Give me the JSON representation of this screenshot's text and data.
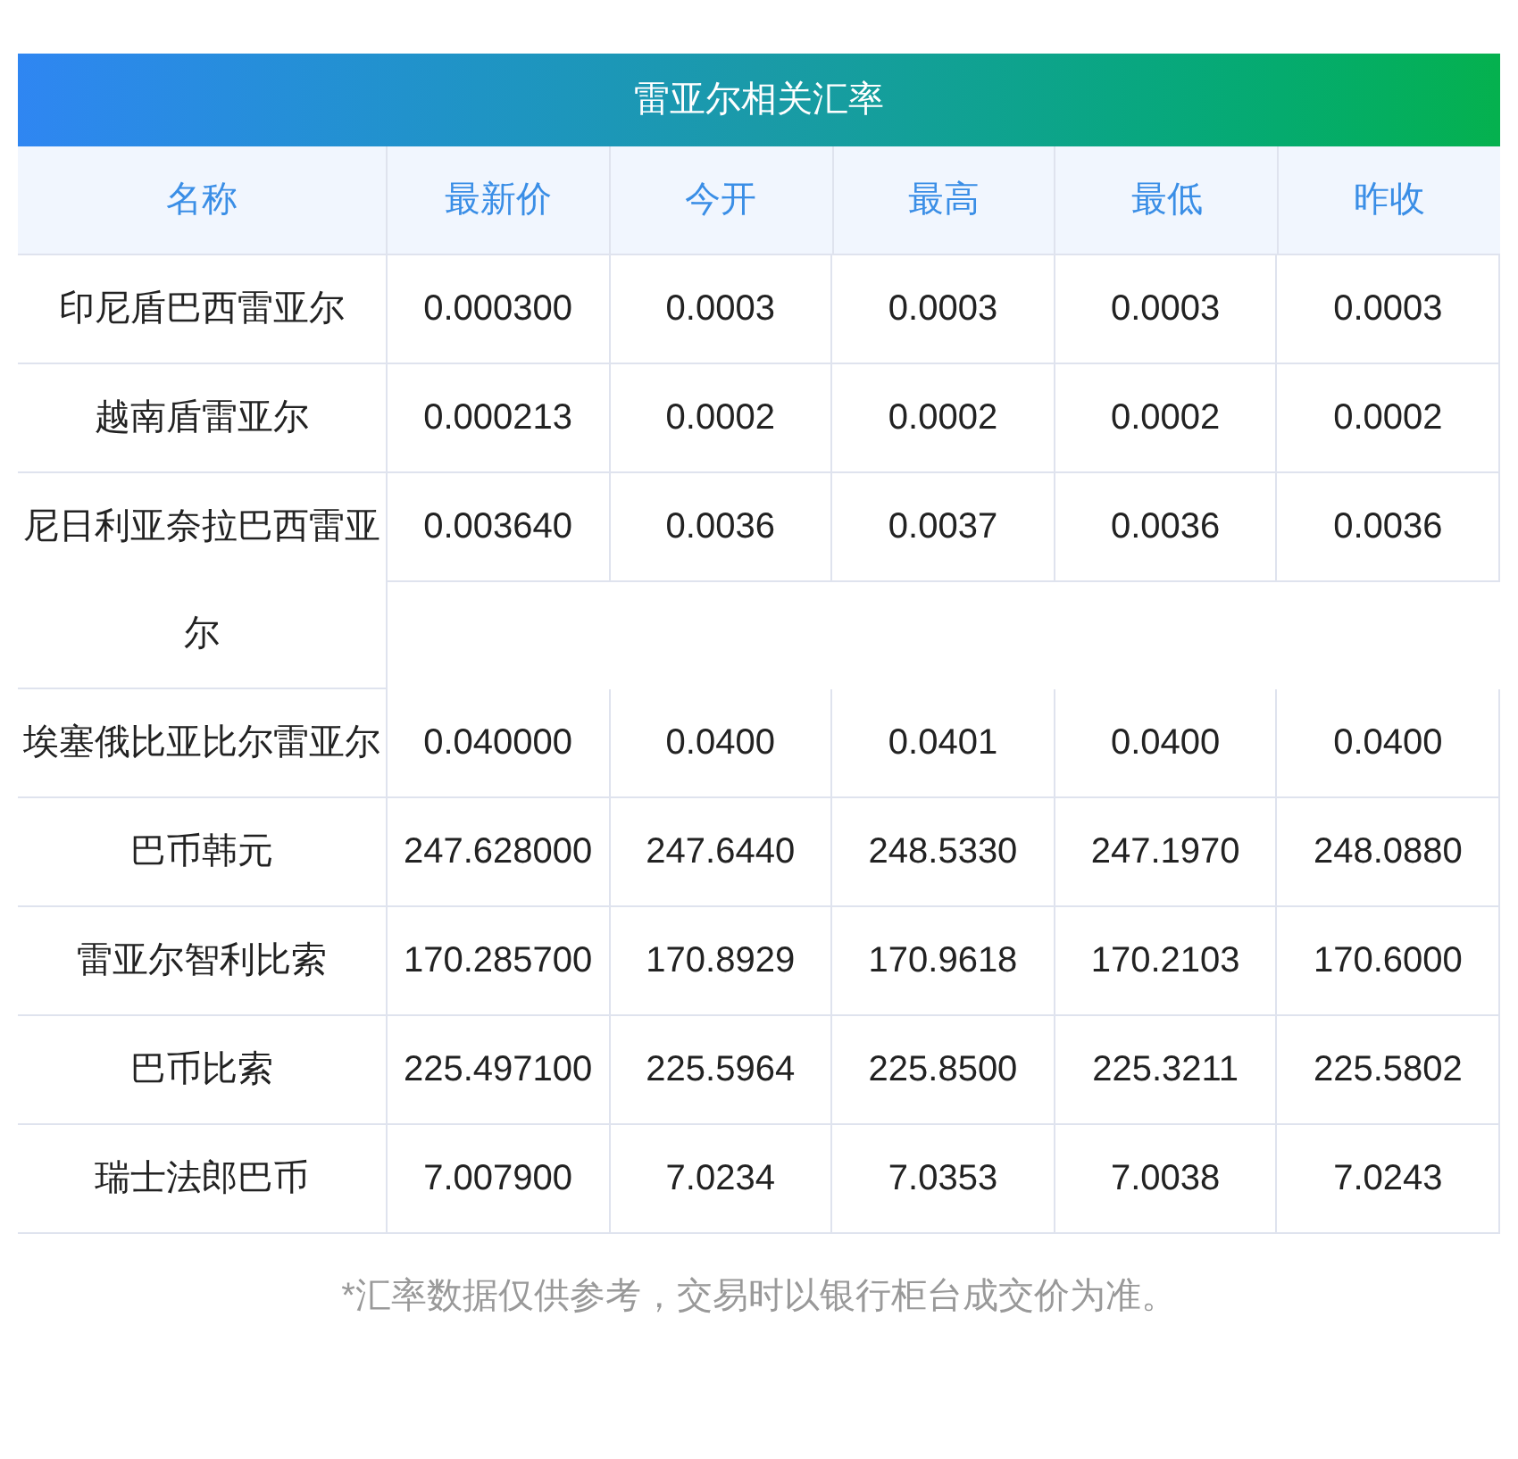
{
  "table": {
    "title": "雷亚尔相关汇率",
    "columns": [
      "名称",
      "最新价",
      "今开",
      "最高",
      "最低",
      "昨收"
    ],
    "rows": [
      {
        "name": "印尼盾巴西雷亚尔",
        "values": [
          "0.000300",
          "0.0003",
          "0.0003",
          "0.0003",
          "0.0003"
        ]
      },
      {
        "name": "越南盾雷亚尔",
        "values": [
          "0.000213",
          "0.0002",
          "0.0002",
          "0.0002",
          "0.0002"
        ]
      },
      {
        "name": "尼日利亚奈拉巴西雷亚尔",
        "values": [
          "0.003640",
          "0.0036",
          "0.0037",
          "0.0036",
          "0.0036"
        ]
      },
      {
        "name": "埃塞俄比亚比尔雷亚尔",
        "values": [
          "0.040000",
          "0.0400",
          "0.0401",
          "0.0400",
          "0.0400"
        ]
      },
      {
        "name": "巴币韩元",
        "values": [
          "247.628000",
          "247.6440",
          "248.5330",
          "247.1970",
          "248.0880"
        ]
      },
      {
        "name": "雷亚尔智利比索",
        "values": [
          "170.285700",
          "170.8929",
          "170.9618",
          "170.2103",
          "170.6000"
        ]
      },
      {
        "name": "巴币比索",
        "values": [
          "225.497100",
          "225.5964",
          "225.8500",
          "225.3211",
          "225.5802"
        ]
      },
      {
        "name": "瑞士法郎巴币",
        "values": [
          "7.007900",
          "7.0234",
          "7.0353",
          "7.0038",
          "7.0243"
        ]
      }
    ]
  },
  "note": "*汇率数据仅供参考，交易时以银行柜台成交价为准。"
}
